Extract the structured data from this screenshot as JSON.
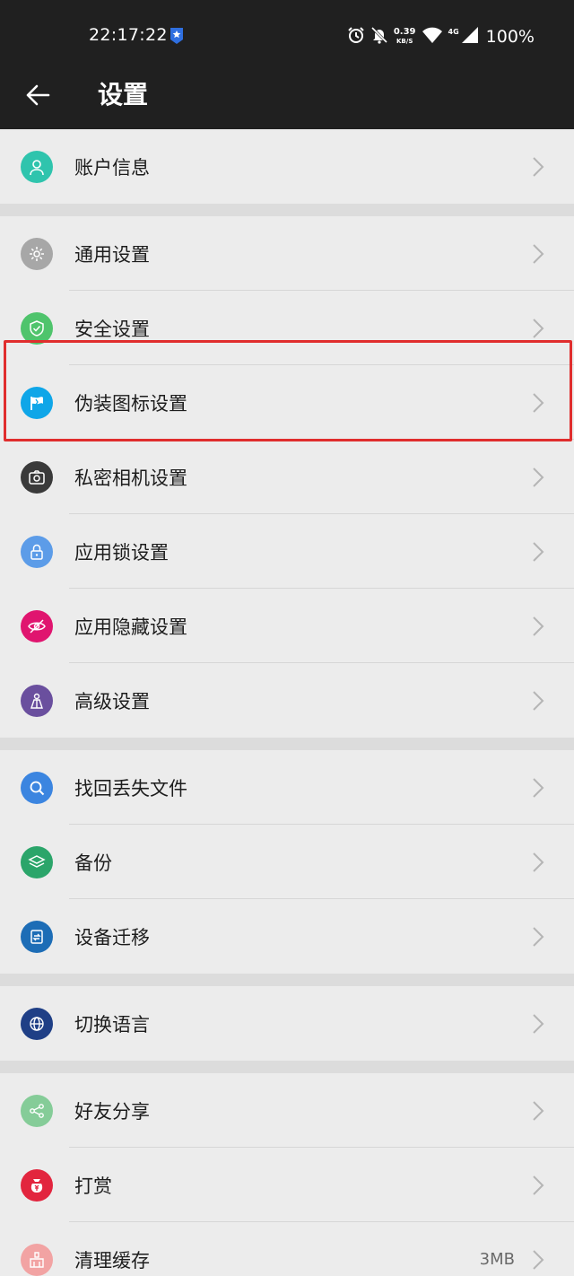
{
  "status_bar": {
    "time": "22:17:22",
    "net_speed": "0.39",
    "net_unit": "KB/S",
    "network_type": "4G",
    "battery": "100%"
  },
  "app_bar": {
    "title": "设置"
  },
  "colors": {
    "bar_bg": "#202020",
    "list_bg": "#ececec",
    "gap_bg": "#dcdcdc",
    "highlight": "#e02d2d"
  },
  "groups": [
    {
      "items": [
        {
          "label": "账户信息",
          "icon": "user-icon",
          "color": "#2fc4ad"
        }
      ]
    },
    {
      "items": [
        {
          "label": "通用设置",
          "icon": "gear-icon",
          "color": "#a7a7a7"
        },
        {
          "label": "安全设置",
          "icon": "shield-icon",
          "color": "#4fc46c"
        },
        {
          "label": "伪装图标设置",
          "icon": "flag-icon",
          "color": "#0fa6e8"
        },
        {
          "label": "私密相机设置",
          "icon": "camera-icon",
          "color": "#3a3a3a"
        },
        {
          "label": "应用锁设置",
          "icon": "lock-icon",
          "color": "#5c9ce8"
        },
        {
          "label": "应用隐藏设置",
          "icon": "eye-off-icon",
          "color": "#e0156f"
        },
        {
          "label": "高级设置",
          "icon": "advanced-icon",
          "color": "#6a4f9e"
        }
      ]
    },
    {
      "items": [
        {
          "label": "找回丢失文件",
          "icon": "search-icon",
          "color": "#3b85e0"
        },
        {
          "label": "备份",
          "icon": "backup-icon",
          "color": "#2ba56a"
        },
        {
          "label": "设备迁移",
          "icon": "migrate-icon",
          "color": "#1d6db6"
        }
      ]
    },
    {
      "items": [
        {
          "label": "切换语言",
          "icon": "globe-icon",
          "color": "#1f3f86"
        }
      ]
    },
    {
      "items": [
        {
          "label": "好友分享",
          "icon": "share-icon",
          "color": "#85cc98"
        },
        {
          "label": "打赏",
          "icon": "reward-icon",
          "color": "#e2253e"
        },
        {
          "label": "清理缓存",
          "icon": "clean-icon",
          "color": "#f2a3a3",
          "value": "3MB"
        }
      ]
    }
  ]
}
